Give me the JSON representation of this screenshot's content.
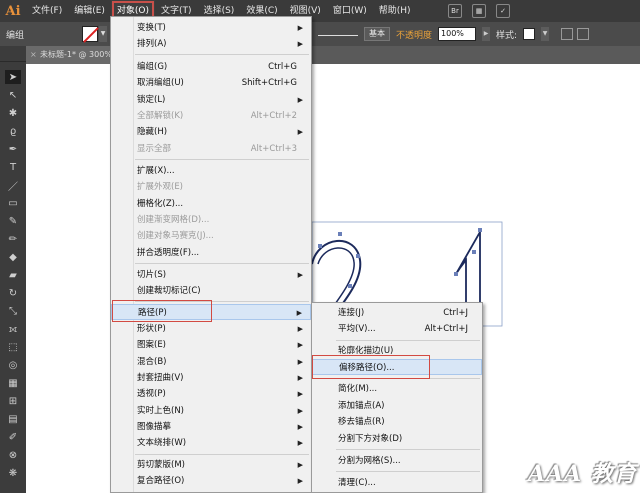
{
  "app": {
    "logo": "Ai"
  },
  "menubar": {
    "items": [
      "文件(F)",
      "编辑(E)",
      "对象(O)",
      "文字(T)",
      "选择(S)",
      "效果(C)",
      "视图(V)",
      "窗口(W)",
      "帮助(H)"
    ],
    "active_index": 2,
    "br_icon": "Br"
  },
  "controlbar": {
    "selection_label": "编组",
    "stroke_style": "基本",
    "opacity_label": "不透明度",
    "opacity_value": "100%",
    "style_label": "样式:"
  },
  "document": {
    "tab_title": "未标题-1* @ 300%"
  },
  "object_menu": {
    "items": [
      {
        "label": "变换(T)",
        "submenu": true
      },
      {
        "label": "排列(A)",
        "submenu": true
      },
      {
        "label": "编组(G)",
        "shortcut": "Ctrl+G"
      },
      {
        "label": "取消编组(U)",
        "shortcut": "Shift+Ctrl+G"
      },
      {
        "label": "锁定(L)",
        "submenu": true
      },
      {
        "label": "全部解锁(K)",
        "shortcut": "Alt+Ctrl+2",
        "disabled": true
      },
      {
        "label": "隐藏(H)",
        "submenu": true
      },
      {
        "label": "显示全部",
        "shortcut": "Alt+Ctrl+3",
        "disabled": true
      },
      {
        "label": "扩展(X)..."
      },
      {
        "label": "扩展外观(E)",
        "disabled": true
      },
      {
        "label": "栅格化(Z)..."
      },
      {
        "label": "创建渐变网格(D)...",
        "disabled": true
      },
      {
        "label": "创建对象马赛克(J)...",
        "disabled": true
      },
      {
        "label": "拼合透明度(F)..."
      },
      {
        "label": "切片(S)",
        "submenu": true
      },
      {
        "label": "创建裁切标记(C)"
      },
      {
        "label": "路径(P)",
        "submenu": true,
        "highlighted": true
      },
      {
        "label": "形状(P)",
        "submenu": true
      },
      {
        "label": "图案(E)",
        "submenu": true
      },
      {
        "label": "混合(B)",
        "submenu": true
      },
      {
        "label": "封套扭曲(V)",
        "submenu": true
      },
      {
        "label": "透视(P)",
        "submenu": true
      },
      {
        "label": "实时上色(N)",
        "submenu": true
      },
      {
        "label": "图像描摹",
        "submenu": true
      },
      {
        "label": "文本绕排(W)",
        "submenu": true
      },
      {
        "label": "剪切蒙版(M)",
        "submenu": true
      },
      {
        "label": "复合路径(O)",
        "submenu": true
      }
    ]
  },
  "path_submenu": {
    "items": [
      {
        "label": "连接(J)",
        "shortcut": "Ctrl+J"
      },
      {
        "label": "平均(V)...",
        "shortcut": "Alt+Ctrl+J"
      },
      {
        "label": "轮廓化描边(U)"
      },
      {
        "label": "偏移路径(O)...",
        "highlighted": true
      },
      {
        "label": "简化(M)..."
      },
      {
        "label": "添加锚点(A)"
      },
      {
        "label": "移去锚点(R)"
      },
      {
        "label": "分割下方对象(D)"
      },
      {
        "label": "分割为网格(S)..."
      },
      {
        "label": "清理(C)..."
      }
    ]
  },
  "watermark": "AAA 教育",
  "colors": {
    "menubar": "#3a3a3a",
    "highlight": "#d24a42",
    "accent": "#e8913a"
  }
}
